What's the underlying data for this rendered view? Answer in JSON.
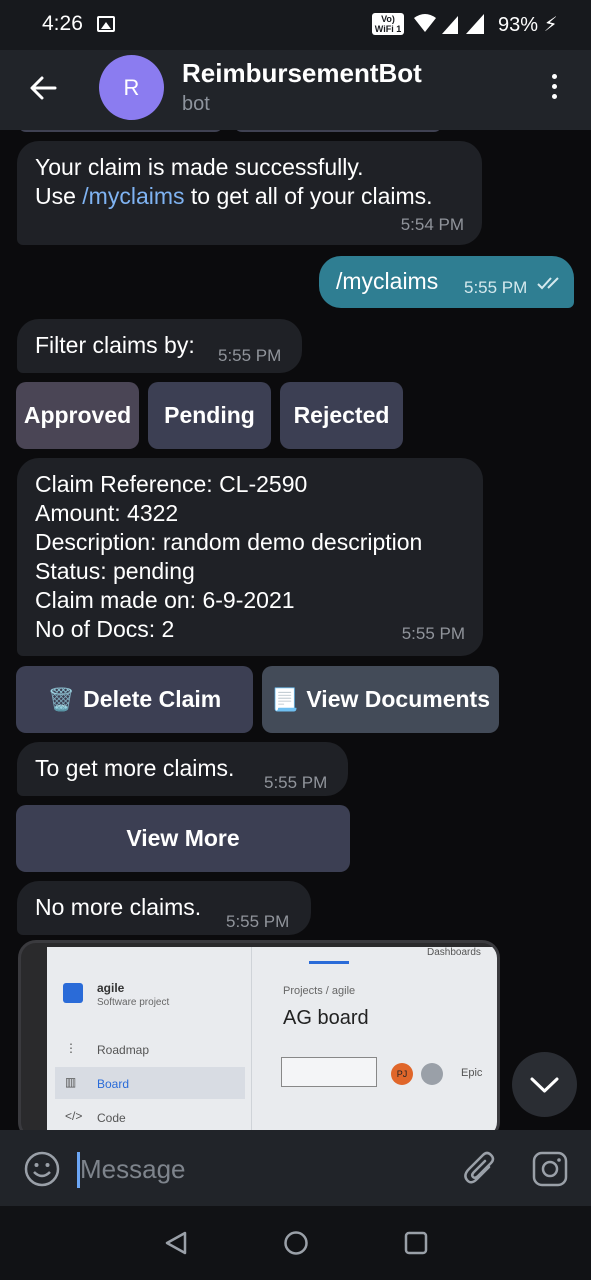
{
  "status_bar": {
    "time": "4:26",
    "vowifi": "Vo) WiFi 1",
    "battery": "93%"
  },
  "header": {
    "avatar_letter": "R",
    "title": "ReimbursementBot",
    "subtitle": "bot"
  },
  "messages": {
    "m1": {
      "line1": "Your claim is made successfully.",
      "line2_prefix": "Use ",
      "command": "/myclaims",
      "line2_suffix": " to get all of your claims.",
      "time": "5:54 PM"
    },
    "m2": {
      "text": "/myclaims",
      "time": "5:55 PM"
    },
    "m3": {
      "text": "Filter claims by:",
      "time": "5:55 PM"
    },
    "filter_buttons": {
      "approved": "Approved",
      "pending": "Pending",
      "rejected": "Rejected"
    },
    "claim": {
      "reference": "Claim Reference: CL-2590",
      "amount": "Amount: 4322",
      "description": "Description: random demo description",
      "status": "Status: pending",
      "made_on": "Claim made on: 6-9-2021",
      "docs": "No of Docs: 2",
      "time": "5:55 PM"
    },
    "claim_buttons": {
      "delete_emoji": "🗑️",
      "delete": "Delete Claim",
      "docs_emoji": "📃",
      "view_docs": "View Documents"
    },
    "m5": {
      "text": "To get more claims.",
      "time": "5:55 PM"
    },
    "view_more": "View More",
    "m6": {
      "text": "No more claims.",
      "time": "5:55 PM"
    }
  },
  "photo": {
    "dashboards": "Dashboards",
    "project_name": "agile",
    "project_type": "Software project",
    "nav": [
      "Roadmap",
      "Board",
      "Code"
    ],
    "breadcrumb": "Projects  /  agile",
    "board_title": "AG board",
    "avatar_initials": "PJ",
    "epic": "Epic"
  },
  "input": {
    "placeholder": "Message"
  }
}
